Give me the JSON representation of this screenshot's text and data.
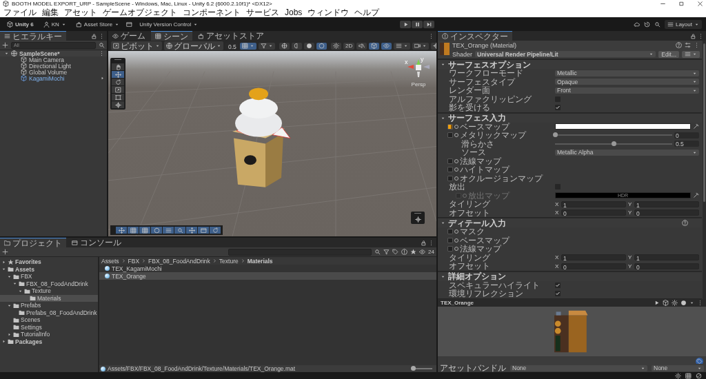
{
  "window": {
    "title": "BOOTH MODEL EXPORT_URP - SampleScene - Windows, Mac, Linux - Unity 6.2 (6000.2.10f1)* <DX12>"
  },
  "menu": [
    "ファイル",
    "編集",
    "アセット",
    "ゲームオブジェクト",
    "コンポーネント",
    "サービス",
    "Jobs",
    "ウィンドウ",
    "ヘルプ"
  ],
  "toolbar": {
    "product": "Unity 6",
    "account": "KN",
    "asset_store": "Asset Store",
    "version_control": "Unity Version Control",
    "layout": "Layout"
  },
  "hierarchy": {
    "tab": "ヒエラルキー",
    "search_placeholder": "All",
    "scene": "SampleScene*",
    "objects": [
      {
        "name": "Main Camera",
        "kind": "object"
      },
      {
        "name": "Directional Light",
        "kind": "object"
      },
      {
        "name": "Global Volume",
        "kind": "object"
      },
      {
        "name": "KagamiMochi",
        "kind": "prefab"
      }
    ]
  },
  "scene_panel": {
    "tabs": [
      {
        "label": "ゲーム",
        "selected": false
      },
      {
        "label": "シーン",
        "selected": true
      },
      {
        "label": "アセットストア",
        "selected": false
      }
    ],
    "pivot": "ピボット",
    "space": "グローバル",
    "snap": "0.5",
    "snap_toggles": [
      {
        "on": true
      },
      {
        "on": false
      }
    ],
    "shading_modes": [
      {
        "selected": false
      },
      {
        "selected": false
      },
      {
        "selected": false
      },
      {
        "selected": true
      }
    ],
    "view_toggles": [
      {
        "kind": "lighting",
        "on": false
      },
      {
        "kind": "flat",
        "label": "2D",
        "on": false
      },
      {
        "kind": "audio",
        "on": false
      },
      {
        "kind": "effects",
        "on": true
      },
      {
        "kind": "visibility",
        "on": true
      }
    ],
    "tools": [
      {
        "selected": false
      },
      {
        "selected": true
      },
      {
        "selected": false
      },
      {
        "selected": false
      },
      {
        "selected": false
      },
      {
        "selected": false
      }
    ],
    "gizmo": {
      "x": "x",
      "y": "y",
      "projection": "Persp"
    }
  },
  "project": {
    "tabs": [
      {
        "label": "プロジェクト",
        "selected": true
      },
      {
        "label": "コンソール",
        "selected": false
      }
    ],
    "count": "24",
    "tree": [
      {
        "label": "Favorites",
        "kind": "favorites",
        "expanded": false
      },
      {
        "label": "Assets",
        "kind": "folder",
        "expanded": true,
        "children": [
          {
            "label": "FBX",
            "kind": "folder",
            "expanded": true,
            "children": [
              {
                "label": "FBX_08_FoodAndDrink",
                "kind": "folder",
                "expanded": true,
                "children": [
                  {
                    "label": "Texture",
                    "kind": "folder",
                    "expanded": true,
                    "children": [
                      {
                        "label": "Materials",
                        "kind": "folder",
                        "selected": true
                      }
                    ]
                  }
                ]
              }
            ]
          },
          {
            "label": "Prefabs",
            "kind": "folder",
            "expanded": true,
            "children": [
              {
                "label": "Prefabs_08_FoodAndDrink",
                "kind": "folder",
                "selected": false
              }
            ]
          },
          {
            "label": "Scenes",
            "kind": "folder",
            "selected": false
          },
          {
            "label": "Settings",
            "kind": "folder",
            "selected": false
          },
          {
            "label": "TutorialInfo",
            "kind": "folder",
            "expanded": false
          }
        ]
      },
      {
        "label": "Packages",
        "kind": "folder",
        "expanded": false
      }
    ],
    "breadcrumb": [
      "Assets",
      "FBX",
      "FBX_08_FoodAndDrink",
      "Texture",
      "Materials"
    ],
    "files": [
      {
        "name": "TEX_KagamiMochi",
        "selected": false
      },
      {
        "name": "TEX_Orange",
        "selected": true
      }
    ],
    "path": "Assets/FBX/FBX_08_FoodAndDrink/Texture/Materials/TEX_Orange.mat",
    "icon_size": {
      "level": 0
    }
  },
  "inspector": {
    "tab": "インスペクター",
    "title": "TEX_Orange (Material)",
    "shader_label": "Shader",
    "shader": "Universal Render Pipeline/Lit",
    "edit": "Edit...",
    "sections": [
      {
        "title": "サーフェスオプション",
        "rows": [
          {
            "kind": "dropdown",
            "label": "ワークフローモード",
            "value": "Metallic"
          },
          {
            "kind": "dropdown",
            "label": "サーフェスタイプ",
            "value": "Opaque"
          },
          {
            "kind": "dropdown",
            "label": "レンダー面",
            "value": "Front"
          },
          {
            "kind": "checkbox",
            "label": "アルファクリッピング",
            "checked": false
          },
          {
            "kind": "checkbox",
            "label": "影を受ける",
            "checked": true
          }
        ]
      },
      {
        "title": "サーフェス入力",
        "rows": [
          {
            "kind": "texture",
            "label": "ベースマップ",
            "assigned": true,
            "color": "#ffffff"
          },
          {
            "kind": "texture",
            "label": "メタリックマップ",
            "assigned": false,
            "level": 0,
            "reading": "0",
            "children": [
              {
                "kind": "slider",
                "label": "滑らかさ",
                "level": 0.5,
                "reading": "0.5"
              },
              {
                "kind": "dropdown",
                "label": "ソース",
                "value": "Metallic Alpha"
              }
            ]
          },
          {
            "kind": "texture",
            "label": "法線マップ",
            "assigned": false
          },
          {
            "kind": "texture",
            "label": "ハイトマップ",
            "assigned": false
          },
          {
            "kind": "texture",
            "label": "オクルージョンマップ",
            "assigned": false
          },
          {
            "kind": "checkbox",
            "label": "放出",
            "checked": false,
            "children": [
              {
                "kind": "texture",
                "label": "放出マップ",
                "assigned": false,
                "disabled": true,
                "color": "#000000",
                "hdr": "HDR"
              }
            ]
          },
          {
            "kind": "vector",
            "label": "タイリング",
            "fields": [
              {
                "axis": "X",
                "value": "1"
              },
              {
                "axis": "Y",
                "value": "1"
              }
            ]
          },
          {
            "kind": "vector",
            "label": "オフセット",
            "fields": [
              {
                "axis": "X",
                "value": "0"
              },
              {
                "axis": "Y",
                "value": "0"
              }
            ]
          }
        ]
      },
      {
        "title": "ディテール入力",
        "help": true,
        "rows": [
          {
            "kind": "texture",
            "label": "マスク",
            "assigned": false
          },
          {
            "kind": "texture",
            "label": "ベースマップ",
            "assigned": false
          },
          {
            "kind": "texture",
            "label": "法線マップ",
            "assigned": false
          },
          {
            "kind": "vector",
            "label": "タイリング",
            "fields": [
              {
                "axis": "X",
                "value": "1"
              },
              {
                "axis": "Y",
                "value": "1"
              }
            ]
          },
          {
            "kind": "vector",
            "label": "オフセット",
            "fields": [
              {
                "axis": "X",
                "value": "0"
              },
              {
                "axis": "Y",
                "value": "0"
              }
            ]
          }
        ]
      },
      {
        "title": "詳細オプション",
        "rows": [
          {
            "kind": "checkbox",
            "label": "スペキュラーハイライト",
            "checked": true
          },
          {
            "kind": "checkbox",
            "label": "環境リフレクション",
            "checked": true
          }
        ]
      }
    ],
    "preview": {
      "title": "TEX_Orange"
    },
    "asset_bundle": {
      "label": "アセットバンドル",
      "name": "None",
      "variant": "None"
    }
  }
}
